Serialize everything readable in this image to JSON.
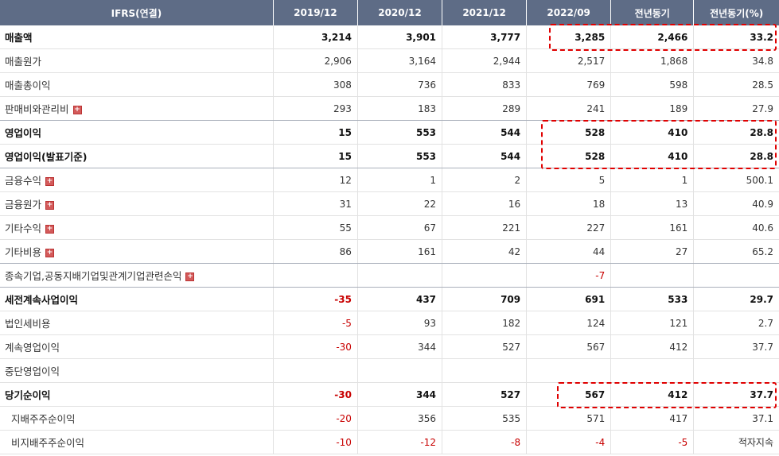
{
  "header": {
    "label": "IFRS(연결)",
    "periods": [
      "2019/12",
      "2020/12",
      "2021/12",
      "2022/09",
      "전년동기",
      "전년동기(%)"
    ]
  },
  "rows": [
    {
      "label": "매출액",
      "values": [
        "3,214",
        "3,901",
        "3,777",
        "3,285",
        "2,466",
        "33.2"
      ]
    },
    {
      "label": "매출원가",
      "values": [
        "2,906",
        "3,164",
        "2,944",
        "2,517",
        "1,868",
        "34.8"
      ]
    },
    {
      "label": "매출총이익",
      "values": [
        "308",
        "736",
        "833",
        "769",
        "598",
        "28.5"
      ]
    },
    {
      "label": "판매비와관리비",
      "values": [
        "293",
        "183",
        "289",
        "241",
        "189",
        "27.9"
      ]
    },
    {
      "label": "영업이익",
      "values": [
        "15",
        "553",
        "544",
        "528",
        "410",
        "28.8"
      ]
    },
    {
      "label": "영업이익(발표기준)",
      "values": [
        "15",
        "553",
        "544",
        "528",
        "410",
        "28.8"
      ]
    },
    {
      "label": "금융수익",
      "values": [
        "12",
        "1",
        "2",
        "5",
        "1",
        "500.1"
      ]
    },
    {
      "label": "금융원가",
      "values": [
        "31",
        "22",
        "16",
        "18",
        "13",
        "40.9"
      ]
    },
    {
      "label": "기타수익",
      "values": [
        "55",
        "67",
        "221",
        "227",
        "161",
        "40.6"
      ]
    },
    {
      "label": "기타비용",
      "values": [
        "86",
        "161",
        "42",
        "44",
        "27",
        "65.2"
      ]
    },
    {
      "label": "종속기업,공동지배기업및관계기업관련손익",
      "values": [
        "",
        "",
        "",
        "-7",
        "",
        ""
      ]
    },
    {
      "label": "세전계속사업이익",
      "values": [
        "-35",
        "437",
        "709",
        "691",
        "533",
        "29.7"
      ]
    },
    {
      "label": "법인세비용",
      "values": [
        "-5",
        "93",
        "182",
        "124",
        "121",
        "2.7"
      ]
    },
    {
      "label": "계속영업이익",
      "values": [
        "-30",
        "344",
        "527",
        "567",
        "412",
        "37.7"
      ]
    },
    {
      "label": "중단영업이익",
      "values": [
        "",
        "",
        "",
        "",
        "",
        ""
      ]
    },
    {
      "label": "당기순이익",
      "values": [
        "-30",
        "344",
        "527",
        "567",
        "412",
        "37.7"
      ]
    },
    {
      "label": "지배주주순이익",
      "values": [
        "-20",
        "356",
        "535",
        "571",
        "417",
        "37.1"
      ]
    },
    {
      "label": "비지배주주순이익",
      "values": [
        "-10",
        "-12",
        "-8",
        "-4",
        "-5",
        "적자지속"
      ]
    }
  ],
  "expand_icon": "+",
  "colors": {
    "header_bg": "#5e6c86",
    "negative": "#c80000",
    "highlight_border": "#e00000",
    "expand_icon": "#d35a5a"
  }
}
